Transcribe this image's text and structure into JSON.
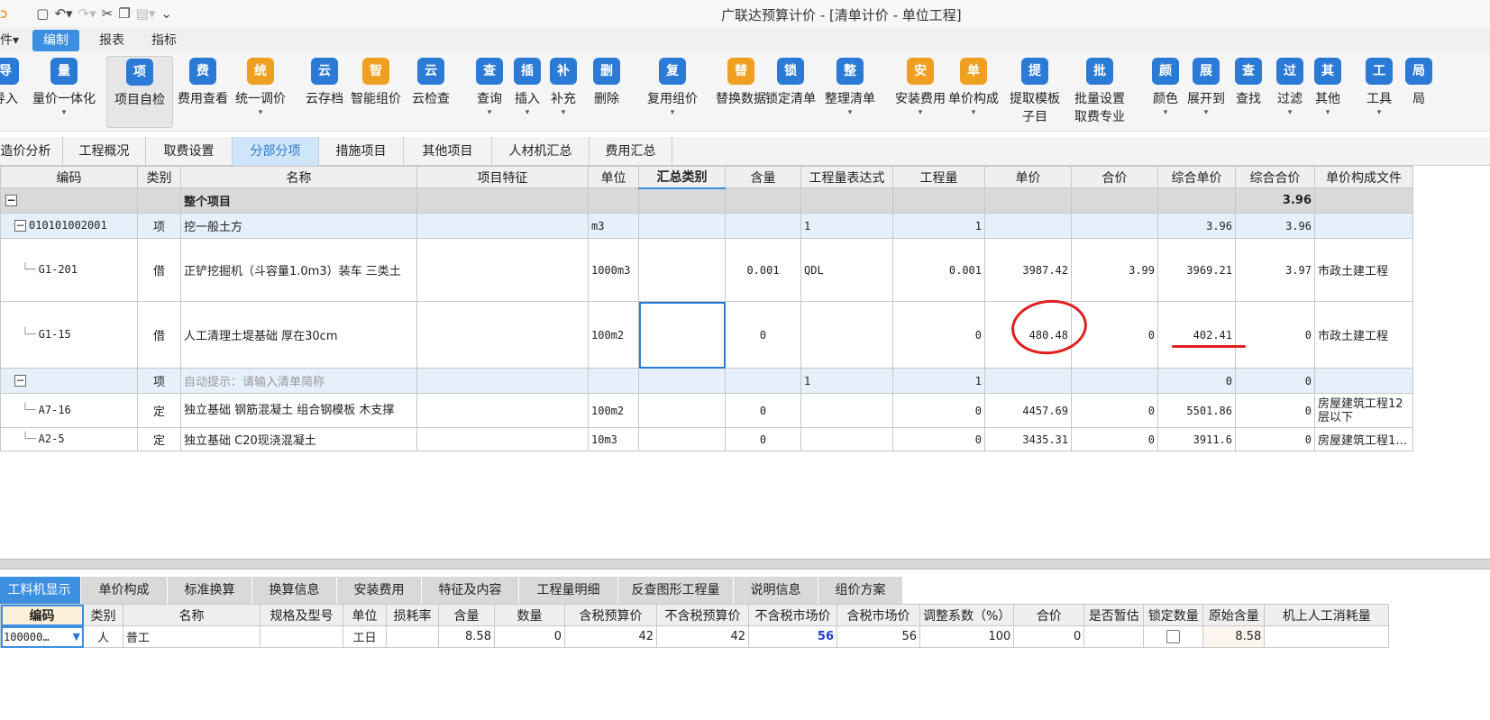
{
  "window": {
    "title": "广联达预算计价 - [清单计价 - 单位工程]"
  },
  "menu": {
    "items": [
      "件▾",
      "编制",
      "报表",
      "指标"
    ]
  },
  "ribbon": [
    {
      "label": "导入",
      "icon": "import-icon",
      "color": "#2a7ad6"
    },
    {
      "label": "量价一体化",
      "icon": "measure-price-icon",
      "color": "#2a7ad6"
    },
    {
      "label": "项目自检",
      "icon": "self-check-icon",
      "color": "#2a7ad6"
    },
    {
      "label": "费用查看",
      "icon": "fee-view-icon",
      "color": "#2a7ad6"
    },
    {
      "label": "统一调价",
      "icon": "price-adjust-icon",
      "color": "#f0a020"
    },
    {
      "label": "云存档",
      "icon": "cloud-save-icon",
      "color": "#2a7ad6"
    },
    {
      "label": "智能组价",
      "icon": "smart-price-icon",
      "color": "#f0a020"
    },
    {
      "label": "云检查",
      "icon": "cloud-check-icon",
      "color": "#2a7ad6"
    },
    {
      "label": "查询",
      "icon": "query-icon",
      "color": "#2a7ad6"
    },
    {
      "label": "插入",
      "icon": "insert-icon",
      "color": "#2a7ad6"
    },
    {
      "label": "补充",
      "icon": "supplement-icon",
      "color": "#2a7ad6"
    },
    {
      "label": "删除",
      "icon": "delete-icon",
      "color": "#2a7ad6"
    },
    {
      "label": "复用组价",
      "icon": "reuse-price-icon",
      "color": "#2a7ad6"
    },
    {
      "label": "替换数据",
      "icon": "replace-data-icon",
      "color": "#f0a020"
    },
    {
      "label": "锁定清单",
      "icon": "lock-list-icon",
      "color": "#2a7ad6"
    },
    {
      "label": "整理清单",
      "icon": "organize-list-icon",
      "color": "#2a7ad6"
    },
    {
      "label": "安装费用",
      "icon": "install-fee-icon",
      "color": "#f0a020"
    },
    {
      "label": "单价构成",
      "icon": "unit-price-structure-icon",
      "color": "#f0a020"
    },
    {
      "label": "提取模板\n子目",
      "icon": "template-icon",
      "color": "#2a7ad6"
    },
    {
      "label": "批量设置\n取费专业",
      "icon": "batch-fee-icon",
      "color": "#2a7ad6"
    },
    {
      "label": "颜色",
      "icon": "color-icon",
      "color": "#2a7ad6"
    },
    {
      "label": "展开到",
      "icon": "expand-to-icon",
      "color": "#2a7ad6"
    },
    {
      "label": "查找",
      "icon": "find-icon",
      "color": "#2a7ad6"
    },
    {
      "label": "过滤",
      "icon": "filter-icon",
      "color": "#2a7ad6"
    },
    {
      "label": "其他",
      "icon": "other-icon",
      "color": "#2a7ad6"
    },
    {
      "label": "工具",
      "icon": "tools-icon",
      "color": "#2a7ad6"
    },
    {
      "label": "局",
      "icon": "partial-icon",
      "color": "#2a7ad6"
    }
  ],
  "tabs": [
    "造价分析",
    "工程概况",
    "取费设置",
    "分部分项",
    "措施项目",
    "其他项目",
    "人材机汇总",
    "费用汇总"
  ],
  "main": {
    "headers": [
      "编码",
      "类别",
      "名称",
      "项目特征",
      "单位",
      "汇总类别",
      "含量",
      "工程量表达式",
      "工程量",
      "单价",
      "合价",
      "综合单价",
      "综合合价",
      "单价构成文件"
    ],
    "rows": [
      {
        "code": "",
        "type": "",
        "name": "整个项目",
        "feature": "",
        "unit": "",
        "sum": "",
        "content": "",
        "expr": "",
        "qty": "",
        "price": "",
        "total": "",
        "uprice": "",
        "utotal": "3.96",
        "file": ""
      },
      {
        "code": "010101002001",
        "type": "项",
        "name": "挖一般土方",
        "feature": "",
        "unit": "m3",
        "sum": "",
        "content": "",
        "expr": "1",
        "qty": "1",
        "price": "",
        "total": "",
        "uprice": "3.96",
        "utotal": "3.96",
        "file": ""
      },
      {
        "code": "G1-201",
        "type": "借",
        "name": "正铲挖掘机（斗容量1.0m3）装车 三类土",
        "feature": "",
        "unit": "1000m3",
        "sum": "",
        "content": "0.001",
        "expr": "QDL",
        "qty": "0.001",
        "price": "3987.42",
        "total": "3.99",
        "uprice": "3969.21",
        "utotal": "3.97",
        "file": "市政土建工程"
      },
      {
        "code": "G1-15",
        "type": "借",
        "name": "人工清理土堤基础 厚在30cm",
        "feature": "",
        "unit": "100m2",
        "sum": "",
        "content": "0",
        "expr": "",
        "qty": "0",
        "price": "480.48",
        "total": "0",
        "uprice": "402.41",
        "utotal": "0",
        "file": "市政土建工程"
      },
      {
        "code": "",
        "type": "项",
        "name": "自动提示：请输入清单简称",
        "feature": "",
        "unit": "",
        "sum": "",
        "content": "",
        "expr": "1",
        "qty": "1",
        "price": "",
        "total": "",
        "uprice": "0",
        "utotal": "0",
        "file": ""
      },
      {
        "code": "A7-16",
        "type": "定",
        "name": "独立基础 钢筋混凝土 组合钢模板 木支撑",
        "feature": "",
        "unit": "100m2",
        "sum": "",
        "content": "0",
        "expr": "",
        "qty": "0",
        "price": "4457.69",
        "total": "0",
        "uprice": "5501.86",
        "utotal": "0",
        "file": "房屋建筑工程12层以下"
      },
      {
        "code": "A2-5",
        "type": "定",
        "name": "独立基础 C20现浇混凝土",
        "feature": "",
        "unit": "10m3",
        "sum": "",
        "content": "0",
        "expr": "",
        "qty": "0",
        "price": "3435.31",
        "total": "0",
        "uprice": "3911.6",
        "utotal": "0",
        "file": "房屋建筑工程1…"
      }
    ]
  },
  "bottom_tabs": [
    "工料机显示",
    "单价构成",
    "标准换算",
    "换算信息",
    "安装费用",
    "特征及内容",
    "工程量明细",
    "反查图形工程量",
    "说明信息",
    "组价方案"
  ],
  "bottom": {
    "headers": [
      "编码",
      "类别",
      "名称",
      "规格及型号",
      "单位",
      "损耗率",
      "含量",
      "数量",
      "含税预算价",
      "不含税预算价",
      "不含税市场价",
      "含税市场价",
      "调整系数（%）",
      "合价",
      "是否暂估",
      "锁定数量",
      "原始含量",
      "机上人工消耗量"
    ],
    "row": {
      "code": "100000…",
      "type": "人",
      "name": "普工",
      "spec": "",
      "unit": "工日",
      "loss": "",
      "content": "8.58",
      "qty": "0",
      "tax_budget": "42",
      "notax_budget": "42",
      "notax_market": "56",
      "tax_market": "56",
      "coef": "100",
      "total": "0",
      "estimate": "",
      "locked": false,
      "orig": "8.58",
      "machine_labor": ""
    }
  },
  "colors": {
    "accent": "#3d8fe0",
    "annotation": "#e02020"
  }
}
